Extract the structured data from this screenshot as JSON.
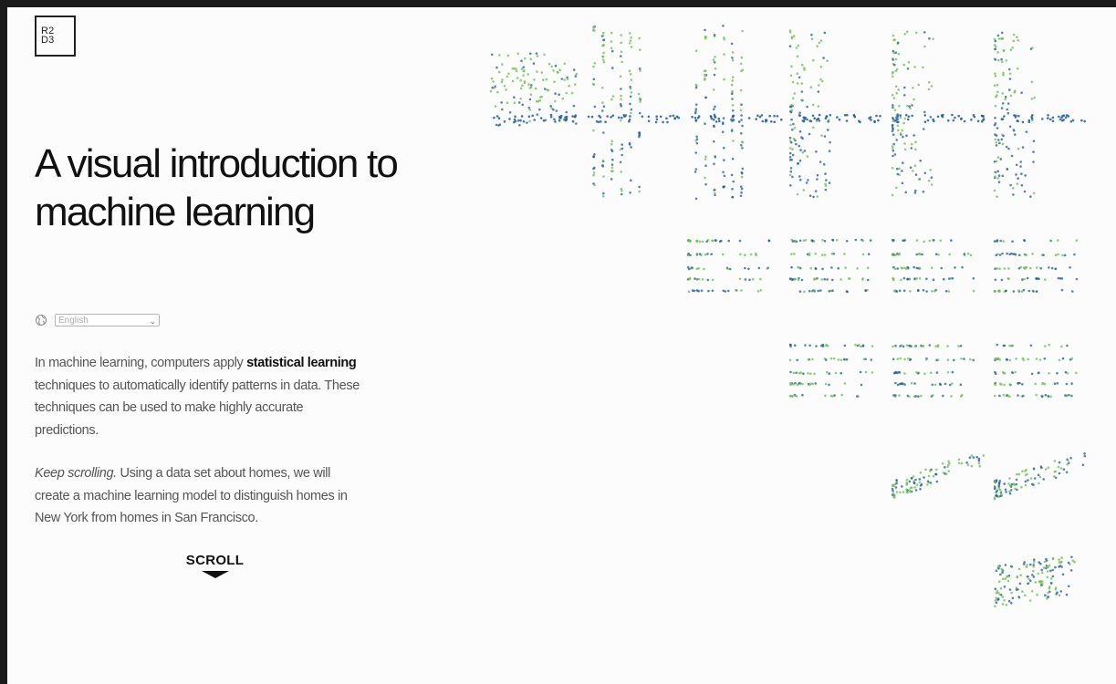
{
  "logo": {
    "line1": "R2",
    "line2": "D3"
  },
  "title": "A visual introduction to machine learning",
  "language": {
    "selected": "English",
    "globe_icon": "globe-icon",
    "chevron_icon": "chevron-down-icon"
  },
  "intro": {
    "p1_a": "In machine learning, computers apply ",
    "p1_bold": "statistical learning",
    "p1_b": " techniques to automatically identify patterns in data. These techniques can be used to make highly accurate predictions.",
    "p2_italic": "Keep scrolling.",
    "p2_rest": " Using a data set about homes, we will create a machine learning model to distinguish homes in New York from homes in San Francisco."
  },
  "scroll": {
    "label": "SCROLL",
    "arrow_icon": "arrow-down-icon"
  },
  "colors": {
    "green": "#6cbf4c",
    "blue": "#1f5c9a"
  },
  "scatter_matrix": {
    "type": "scatterplot-matrix",
    "grid": "upper-triangular",
    "series": [
      "green points",
      "blue points"
    ]
  }
}
